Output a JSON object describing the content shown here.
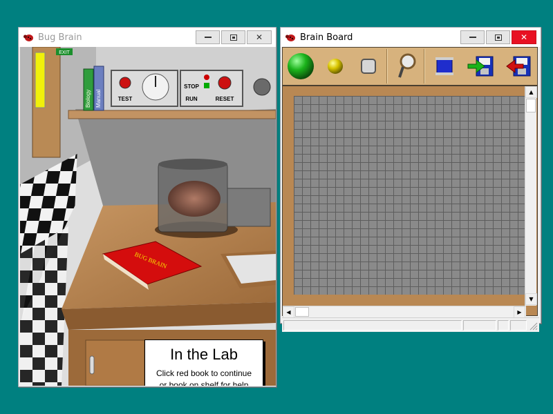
{
  "desktop": {
    "background": "#008080"
  },
  "bug_brain_window": {
    "title": "Bug Brain",
    "state": "inactive",
    "scene": {
      "exit_sign": "EXIT",
      "shelf_books": [
        "Biology",
        "Manual"
      ],
      "control_panel": {
        "test_label": "TEST",
        "stop_label": "STOP",
        "run_label": "RUN",
        "reset_label": "RESET"
      },
      "red_book_label": "BUG BRAIN"
    },
    "caption": {
      "heading": "In the Lab",
      "line1": "Click red book to continue",
      "line2": "or book on shelf for help"
    }
  },
  "brain_board_window": {
    "title": "Brain Board",
    "state": "active",
    "toolbar": {
      "tools": [
        "green-ball-icon",
        "yellow-ball-icon",
        "gray-square-icon",
        "magnifier-icon",
        "blue-spool-icon",
        "green-arrow-disk-icon",
        "red-arrow-disk-icon"
      ]
    },
    "scroll": {
      "vertical": "0",
      "horizontal": "0"
    }
  },
  "colors": {
    "title_active_close": "#e81123",
    "toolbar_wood": "#d7b27d",
    "board_wood": "#b98853",
    "grid": "#8a8a8a"
  }
}
